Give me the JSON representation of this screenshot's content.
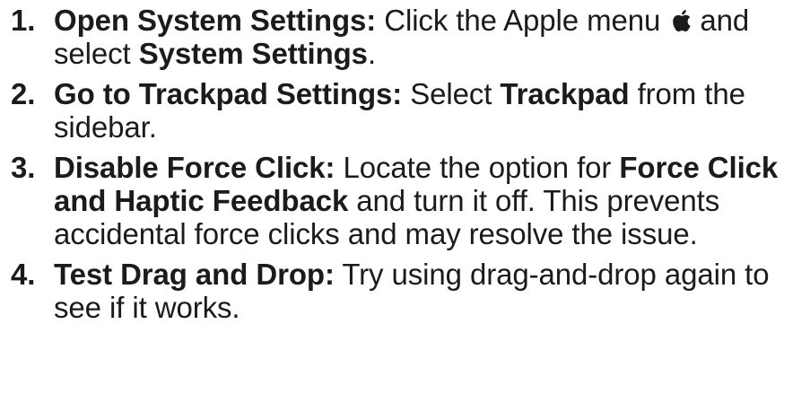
{
  "steps": [
    {
      "number": "1.",
      "heading": "Open System Settings:",
      "t1": " Click the Apple menu ",
      "icon": "apple-logo-icon",
      "t2": " and select ",
      "b1": "System Settings",
      "t3": "."
    },
    {
      "number": "2.",
      "heading": "Go to Trackpad Settings:",
      "t1": " Select ",
      "b1": "Trackpad",
      "t2": " from the sidebar."
    },
    {
      "number": "3.",
      "heading": "Disable Force Click:",
      "t1": " Locate the option for ",
      "b1": "Force Click and Haptic Feedback",
      "t2": " and turn it off. This prevents accidental force clicks and may resolve the issue."
    },
    {
      "number": "4.",
      "heading": "Test Drag and Drop:",
      "t1": " Try using drag-and-drop again to see if it works."
    }
  ]
}
